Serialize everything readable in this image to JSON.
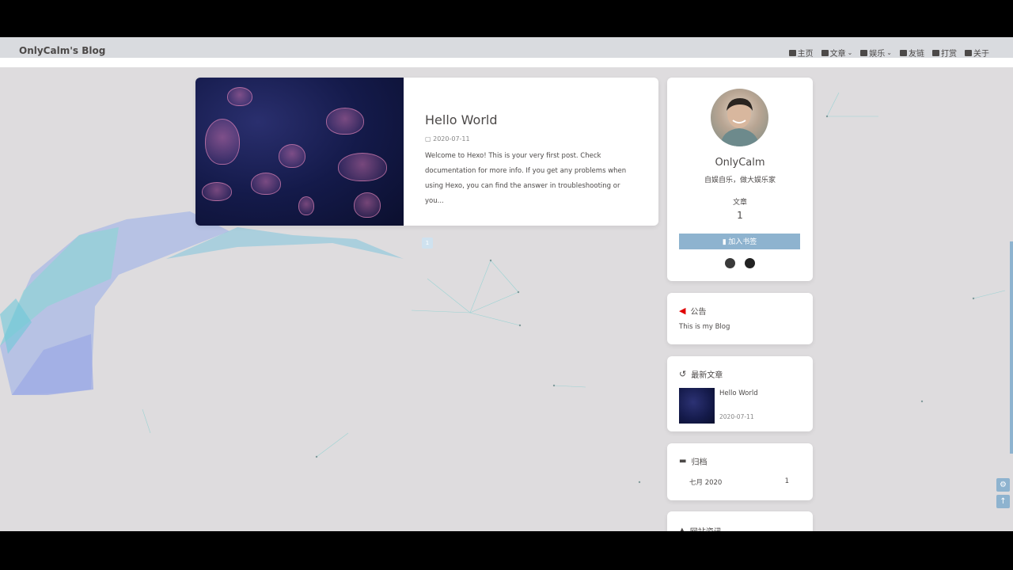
{
  "site": {
    "name": "OnlyCalm's Blog"
  },
  "menu": [
    {
      "label": "主页",
      "icon": "home-icon",
      "dropdown": false
    },
    {
      "label": "文章",
      "icon": "book-icon",
      "dropdown": true
    },
    {
      "label": "娱乐",
      "icon": "music-icon",
      "dropdown": true
    },
    {
      "label": "友链",
      "icon": "users-icon",
      "dropdown": false
    },
    {
      "label": "打赏",
      "icon": "gift-icon",
      "dropdown": false
    },
    {
      "label": "关于",
      "icon": "heart-icon",
      "dropdown": false
    }
  ],
  "post": {
    "title": "Hello World",
    "date": "2020-07-11",
    "excerpt": "Welcome to Hexo! This is your very first post. Check documentation for more info. If you get any problems when using Hexo, you can find the answer in troubleshooting or you..."
  },
  "pagination": {
    "current": "1"
  },
  "profile": {
    "author": "OnlyCalm",
    "description": "自娱自乐，做大娱乐家",
    "articles_label": "文章",
    "articles_count": "1",
    "bookmark_label": "加入书签",
    "social_icons": [
      "github-icon",
      "csdn-icon"
    ]
  },
  "announcement": {
    "title": "公告",
    "text": "This is my Blog"
  },
  "recent": {
    "title": "最新文章",
    "items": [
      {
        "title": "Hello World",
        "date": "2020-07-11"
      }
    ]
  },
  "archive": {
    "title": "归档",
    "items": [
      {
        "month": "七月 2020",
        "count": "1"
      }
    ]
  },
  "site_info": {
    "title": "网站资讯"
  },
  "colors": {
    "accent": "#8eb3cf",
    "announce_icon": "#e00000",
    "page_bg": "#dedcde"
  }
}
